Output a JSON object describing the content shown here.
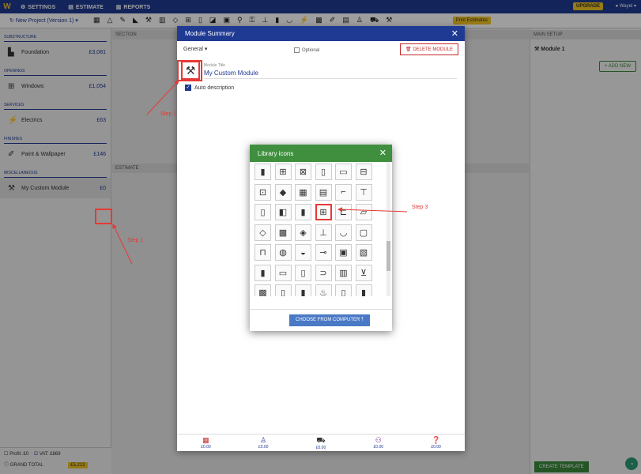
{
  "topbar": {
    "logo": "W",
    "settings": "SETTINGS",
    "estimate": "ESTIMATE",
    "reports": "REPORTS",
    "upgrade": "UPGRADE",
    "user": "Wayel"
  },
  "toolbar": {
    "project": "New Project (Version 1)",
    "pdf": "Print Estimates"
  },
  "sidebar": {
    "categories": [
      {
        "label": "SUBSTRUCTURE",
        "module": {
          "name": "Foundation",
          "price": "£3,081"
        }
      },
      {
        "label": "OPENINGS",
        "module": {
          "name": "Windows",
          "price": "£1,054"
        }
      },
      {
        "label": "SERVICES",
        "module": {
          "name": "Electrics",
          "price": "£63"
        }
      },
      {
        "label": "FINISHES",
        "module": {
          "name": "Paint & Wallpaper",
          "price": "£146"
        }
      },
      {
        "label": "MISCELLANEOUS",
        "module": {
          "name": "My Custom Module",
          "price": "£0"
        }
      }
    ],
    "profit": "Profit: £0",
    "vat": "VAT: £869",
    "grand_total": "GRAND TOTAL",
    "grand_value": "£5,213"
  },
  "panels": {
    "section": "SECTION",
    "estimate": "ESTIMATE",
    "main_setup": "MAIN SETUP",
    "module1": "Module 1",
    "add_new": "+ ADD NEW",
    "create_template": "CREATE TEMPLATE"
  },
  "dialog": {
    "title": "Module Summary",
    "general": "General",
    "optional": "Optional",
    "delete": "DELETE MODULE",
    "title_label": "Module Title",
    "title_value": "My Custom Module",
    "auto_description": "Auto description",
    "footer": [
      {
        "label": "£0.00"
      },
      {
        "label": "£0.00"
      },
      {
        "label": "£0.00"
      },
      {
        "label": "£0.00"
      },
      {
        "label": "£0.00"
      }
    ]
  },
  "library": {
    "title": "Library icons",
    "choose": "CHOOSE FROM COMPUTER"
  },
  "annotations": {
    "step1": "Step 1",
    "step2": "Step 2",
    "step3": "Step 3"
  }
}
